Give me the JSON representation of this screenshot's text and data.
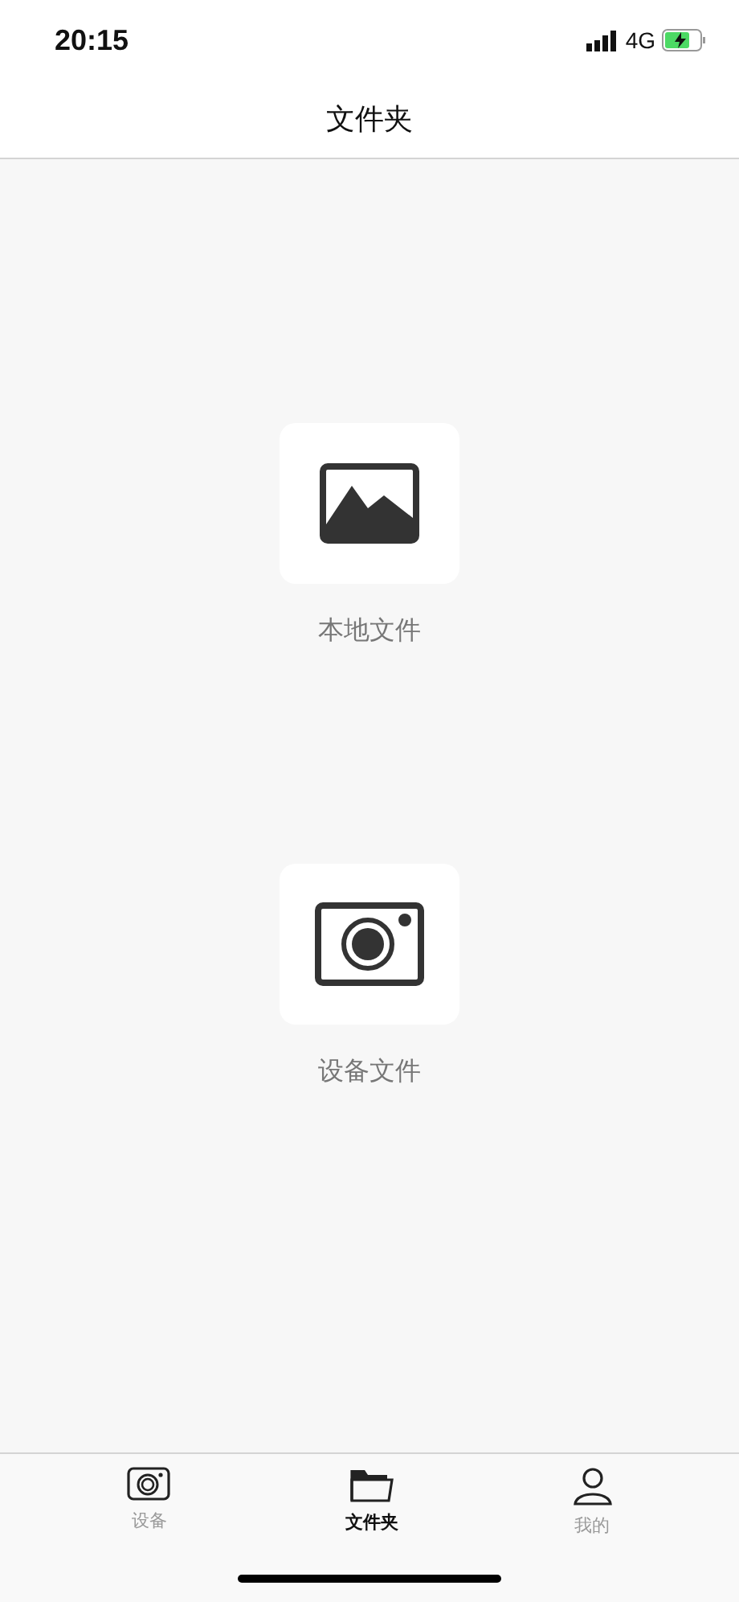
{
  "status_bar": {
    "time": "20:15",
    "network": "4G"
  },
  "header": {
    "title": "文件夹"
  },
  "entries": [
    {
      "kind": "picture",
      "label": "本地文件"
    },
    {
      "kind": "camera",
      "label": "设备文件"
    }
  ],
  "tab_bar": [
    {
      "kind": "camera",
      "label": "设备",
      "selected": false
    },
    {
      "kind": "folder",
      "label": "文件夹",
      "selected": true
    },
    {
      "kind": "person",
      "label": "我的",
      "selected": false
    }
  ]
}
